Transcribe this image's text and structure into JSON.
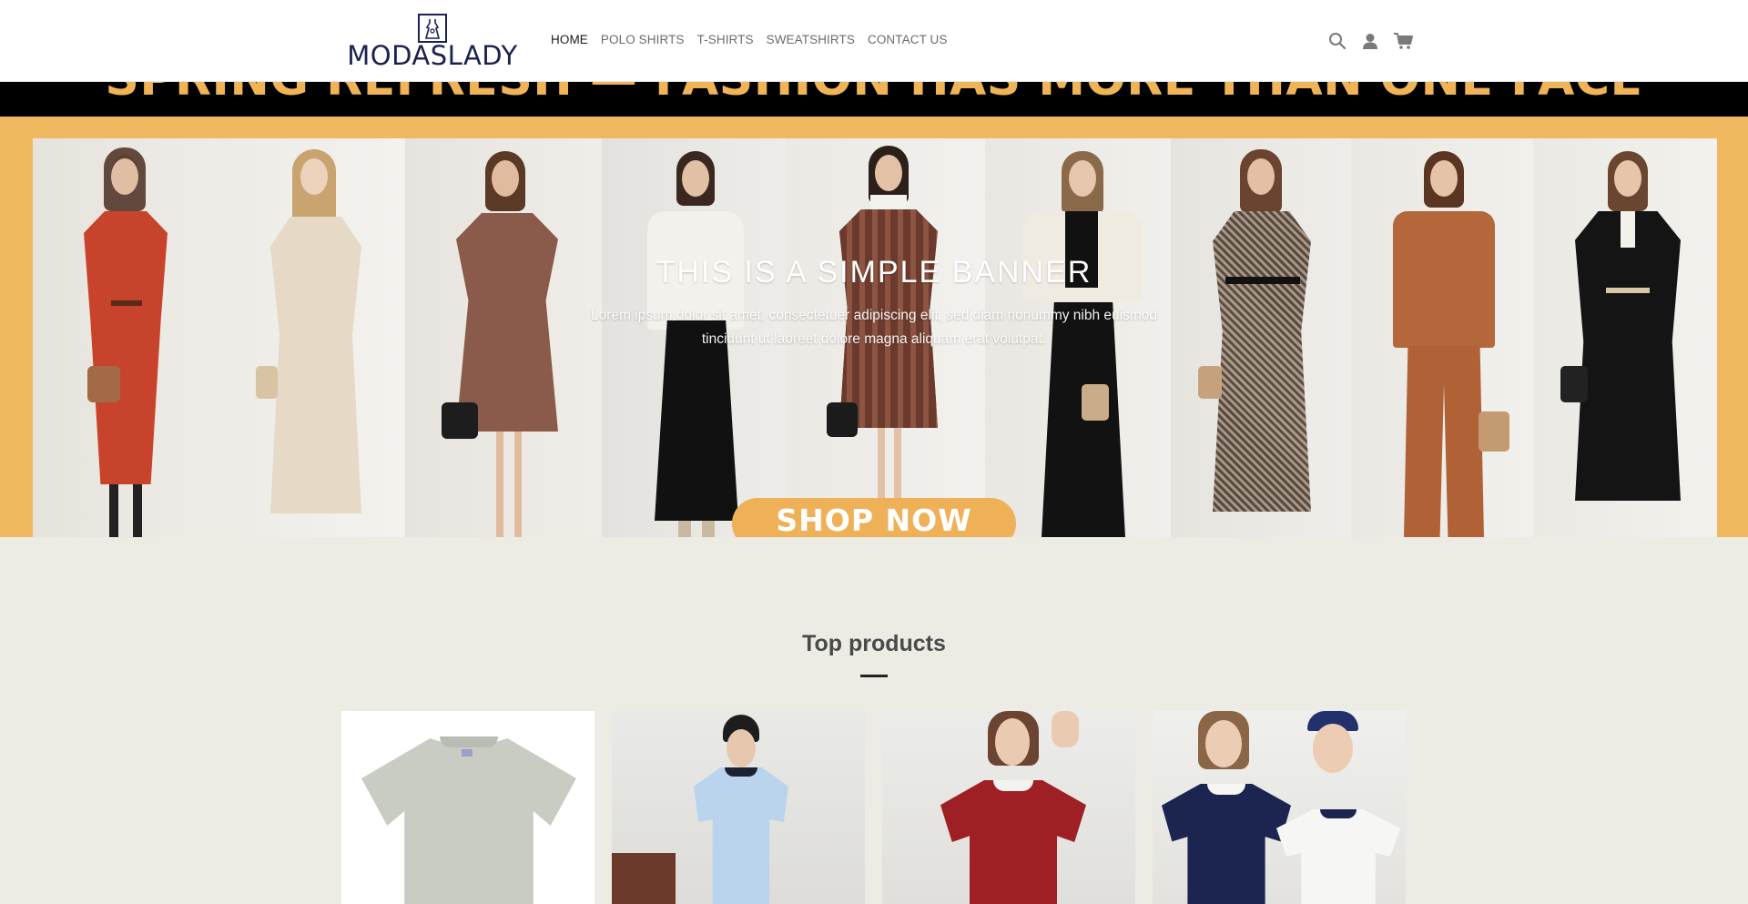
{
  "header": {
    "logo_text": "MODASLADY",
    "nav": [
      {
        "label": "HOME",
        "active": true
      },
      {
        "label": "POLO SHIRTS",
        "active": false
      },
      {
        "label": "T-SHIRTS",
        "active": false
      },
      {
        "label": "SWEATSHIRTS",
        "active": false
      },
      {
        "label": "CONTACT US",
        "active": false
      }
    ],
    "icons": [
      "search-icon",
      "account-icon",
      "cart-icon"
    ]
  },
  "promo": {
    "text": "SPRING REFRESH — FASHION HAS MORE THAN ONE FACE"
  },
  "banner": {
    "title": "THIS IS A SIMPLE BANNER",
    "subtitle": "Lorem ipsum dolor sit amet, consectetuer adipiscing elit, sed diam nonummy nibh euismod tincidunt ut laoreet dolore magna aliquam erat volutpat.",
    "button_label": "SHOP NOW",
    "accent_color": "#f0b85e"
  },
  "top_products": {
    "title": "Top products",
    "items": [
      {
        "name": "sage-tshirt"
      },
      {
        "name": "light-blue-ringer-tee"
      },
      {
        "name": "burgundy-ringer-tee"
      },
      {
        "name": "navy-white-ringer-tees"
      }
    ]
  },
  "colors": {
    "brand": "#1c2152",
    "promo_text": "#f0b457",
    "page_background": "#ecebe4"
  }
}
